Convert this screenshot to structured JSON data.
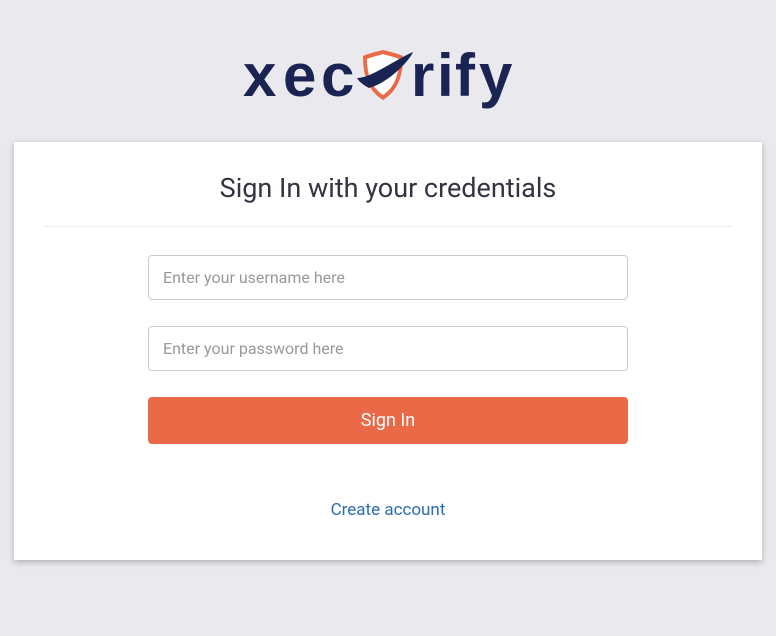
{
  "logo": {
    "brand_name": "xecurify"
  },
  "card": {
    "title": "Sign In with your credentials",
    "username_placeholder": "Enter your username here",
    "username_value": "",
    "password_placeholder": "Enter your password here",
    "password_value": "",
    "signin_button_label": "Sign In",
    "create_account_label": "Create account"
  },
  "colors": {
    "accent": "#ea6a47",
    "link": "#2a6db5",
    "background": "#e9e9ee",
    "navy": "#1a2452"
  }
}
